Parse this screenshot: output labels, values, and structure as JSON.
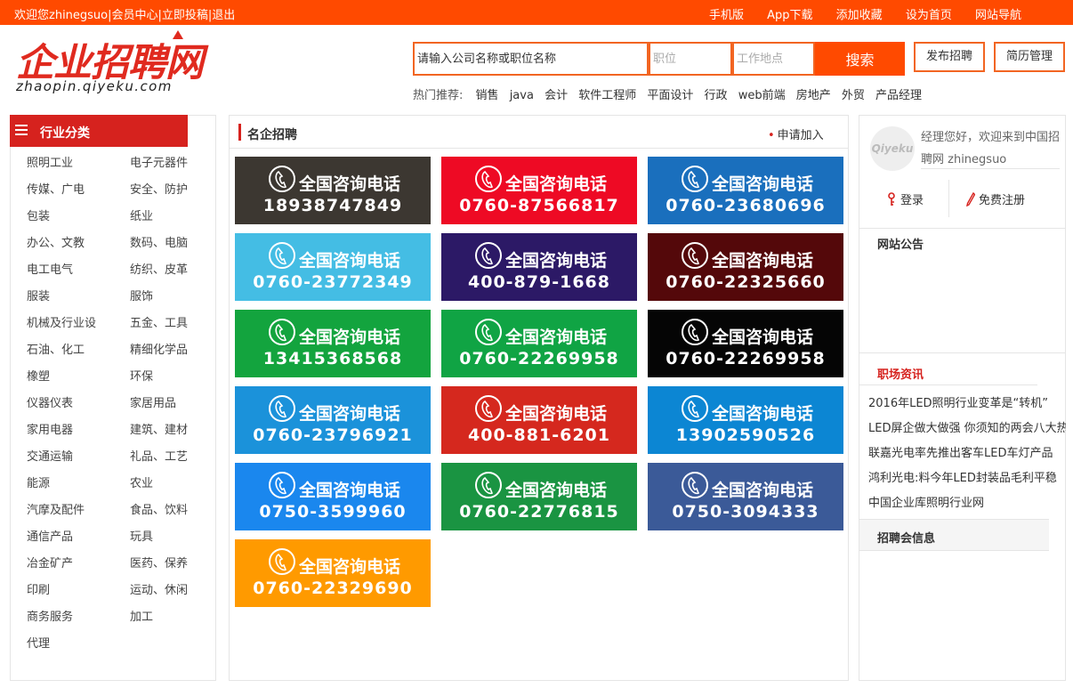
{
  "topbar": {
    "welcome": "欢迎您zhinegsuo|会员中心|",
    "submit": "立即投稿",
    "logout": "|退出",
    "links": [
      "手机版",
      "App下载",
      "添加收藏",
      "设为首页",
      "网站导航"
    ]
  },
  "logo": {
    "cn": "企业招聘网",
    "en": "zhaopin.qiyeku.com"
  },
  "search": {
    "keyword_placeholder": "请输入公司名称或职位名称",
    "position_placeholder": "职位",
    "location_placeholder": "工作地点",
    "button": "搜索"
  },
  "header_buttons": {
    "post": "发布招聘",
    "resume": "简历管理"
  },
  "hot": {
    "label": "热门推荐:",
    "tags": [
      "销售",
      "java",
      "会计",
      "软件工程师",
      "平面设计",
      "行政",
      "web前端",
      "房地产",
      "外贸",
      "产品经理"
    ]
  },
  "categories": {
    "title": "行业分类",
    "items": [
      "照明工业",
      "电子元器件",
      "传媒、广电",
      "安全、防护",
      "包装",
      "纸业",
      "办公、文教",
      "数码、电脑",
      "电工电气",
      "纺织、皮革",
      "服装",
      "服饰",
      "机械及行业设",
      "五金、工具",
      "石油、化工",
      "精细化学品",
      "橡塑",
      "环保",
      "仪器仪表",
      "家居用品",
      "家用电器",
      "建筑、建材",
      "交通运输",
      "礼品、工艺",
      "能源",
      "农业",
      "汽摩及配件",
      "食品、饮料",
      "通信产品",
      "玩具",
      "冶金矿产",
      "医药、保养",
      "印刷",
      "运动、休闲",
      "商务服务",
      "加工",
      "代理"
    ]
  },
  "main": {
    "title": "名企招聘",
    "apply": "申请加入",
    "tiles": [
      {
        "label": "全国咨询电话",
        "phone": "18938747849",
        "color": "#3c3731"
      },
      {
        "label": "全国咨询电话",
        "phone": "0760-87566817",
        "color": "#ee0a24"
      },
      {
        "label": "全国咨询电话",
        "phone": "0760-23680696",
        "color": "#1a6fbd"
      },
      {
        "label": "全国咨询电话",
        "phone": "0760-23772349",
        "color": "#44bde4"
      },
      {
        "label": "全国咨询电话",
        "phone": "400-879-1668",
        "color": "#2c1966"
      },
      {
        "label": "全国咨询电话",
        "phone": "0760-22325660",
        "color": "#54080a"
      },
      {
        "label": "全国咨询电话",
        "phone": "13415368568",
        "color": "#13a43e"
      },
      {
        "label": "全国咨询电话",
        "phone": "0760-22269958",
        "color": "#10a444"
      },
      {
        "label": "全国咨询电话",
        "phone": "0760-22269958",
        "color": "#050505"
      },
      {
        "label": "全国咨询电话",
        "phone": "0760-23796921",
        "color": "#1b92da"
      },
      {
        "label": "全国咨询电话",
        "phone": "400-881-6201",
        "color": "#d5281e"
      },
      {
        "label": "全国咨询电话",
        "phone": "13902590526",
        "color": "#0c86d3"
      },
      {
        "label": "全国咨询电话",
        "phone": "0750-3599960",
        "color": "#1a87ee"
      },
      {
        "label": "全国咨询电话",
        "phone": "0760-22776815",
        "color": "#1a9442"
      },
      {
        "label": "全国咨询电话",
        "phone": "0750-3094333",
        "color": "#3b5a98"
      },
      {
        "label": "全国咨询电话",
        "phone": "0760-22329690",
        "color": "#ff9a00"
      }
    ]
  },
  "sidebar": {
    "avatar_text": "Qiyeku",
    "greeting": "经理您好，欢迎来到中国招聘网 zhinegsuo",
    "login": "登录",
    "register": "免费注册",
    "notice_title": "网站公告",
    "news_title": "职场资讯",
    "news": [
      "2016年LED照明行业变革是“转机”",
      "LED屏企做大做强 你须知的两会八大热",
      "联嘉光电率先推出客车LED车灯产品",
      "鸿利光电:料今年LED封装品毛利平稳",
      "中国企业库照明行业网"
    ],
    "jobfair_title": "招聘会信息"
  },
  "colors": {
    "brand": "#ff4a00",
    "accent_red": "#d6221e",
    "border_orange": "#f26522"
  }
}
